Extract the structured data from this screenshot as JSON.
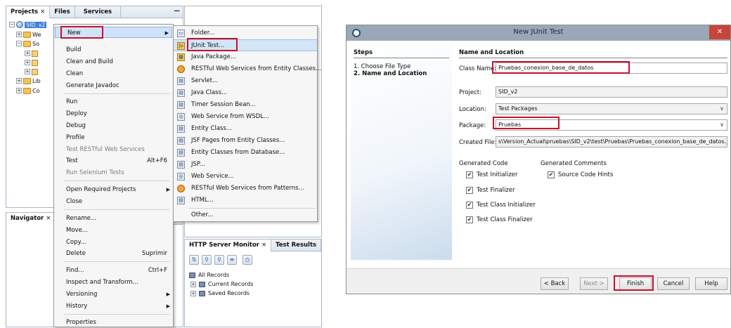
{
  "ide": {
    "tabs": [
      "Projects",
      "Files",
      "Services"
    ],
    "tab_close": "×",
    "minimize": "—",
    "tree": {
      "root": "SID_v2",
      "items": [
        "We",
        "So",
        "Lib",
        "Co"
      ]
    },
    "navigator_tab": "Navigator",
    "http_tabs": [
      "HTTP Server Monitor",
      "Test Results"
    ],
    "records": {
      "all": "All Records",
      "current": "Current Records",
      "saved": "Saved Records"
    }
  },
  "context_menu": {
    "items": [
      {
        "label": "New",
        "submenu": true
      },
      {
        "label": "Build"
      },
      {
        "label": "Clean and Build"
      },
      {
        "label": "Clean"
      },
      {
        "label": "Generate Javadoc"
      },
      {
        "label": "Run"
      },
      {
        "label": "Deploy"
      },
      {
        "label": "Debug"
      },
      {
        "label": "Profile"
      },
      {
        "label": "Test RESTful Web Services",
        "disabled": true
      },
      {
        "label": "Test",
        "shortcut": "Alt+F6"
      },
      {
        "label": "Run Selenium Tests",
        "disabled": true
      },
      {
        "label": "Open Required Projects"
      },
      {
        "label": "Close"
      },
      {
        "label": "Rename..."
      },
      {
        "label": "Move..."
      },
      {
        "label": "Copy..."
      },
      {
        "label": "Delete",
        "shortcut": "Suprimir"
      },
      {
        "label": "Find...",
        "shortcut": "Ctrl+F"
      },
      {
        "label": "Inspect and Transform..."
      },
      {
        "label": "Versioning",
        "submenu": true
      },
      {
        "label": "History",
        "submenu": true
      },
      {
        "label": "Properties"
      }
    ]
  },
  "new_submenu": {
    "items": [
      "Folder...",
      "JUnit Test...",
      "Java Package...",
      "RESTful Web Services from Entity Classes...",
      "Servlet...",
      "Java Class...",
      "Timer Session Bean...",
      "Web Service from WSDL...",
      "Entity Class...",
      "JSF Pages from Entity Classes...",
      "Entity Classes from Database...",
      "JSP...",
      "Web Service...",
      "RESTful Web Services from Patterns...",
      "HTML...",
      "Other..."
    ]
  },
  "dialog": {
    "title": "New JUnit Test",
    "close": "✕",
    "steps_heading": "Steps",
    "steps": [
      "1.   Choose File Type",
      "2.   Name and Location"
    ],
    "section_heading": "Name and Location",
    "class_name_label": "Class Name:",
    "class_name_value": "Pruebas_conexion_base_de_datos",
    "project_label": "Project:",
    "project_value": "SID_v2",
    "location_label": "Location:",
    "location_value": "Test Packages",
    "package_label": "Package:",
    "package_value": "Pruebas",
    "created_label": "Created File:",
    "created_value": "s\\Version_Actual\\pruebas\\SID_v2\\test\\Pruebas\\Pruebas_conexion_base_de_datos.java",
    "generated_code_heading": "Generated Code",
    "generated_comments_heading": "Generated Comments",
    "checks": [
      "Test Initializer",
      "Test Finalizer",
      "Test Class Initializer",
      "Test Class Finalizer"
    ],
    "comment_check": "Source Code Hints",
    "buttons": {
      "back": "< Back",
      "next": "Next >",
      "finish": "Finish",
      "cancel": "Cancel",
      "help": "Help"
    }
  },
  "colors": {
    "highlight_box": "#c8102e",
    "selection": "#3c7fd5"
  }
}
